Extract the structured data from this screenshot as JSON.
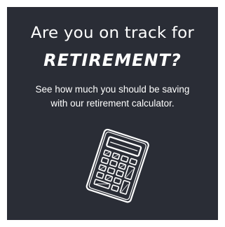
{
  "promo": {
    "headline": "Are you on track for",
    "highlight": "RETIREMENT?",
    "subtext_line1": "See how much you should be saving",
    "subtext_line2": "with our retirement calculator."
  },
  "icons": {
    "illustration": "calculator-icon"
  },
  "colors": {
    "card_background": "#2a2d36",
    "text": "#ffffff"
  }
}
